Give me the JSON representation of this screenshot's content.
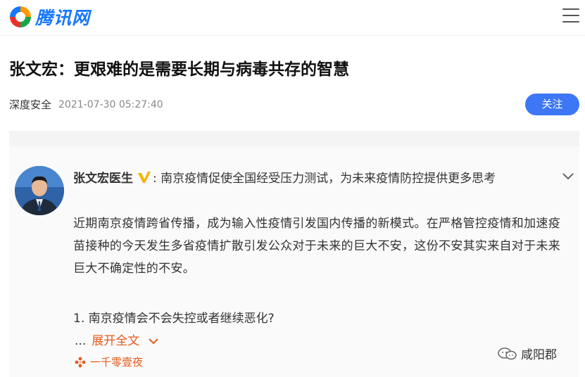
{
  "header": {
    "logo_text": "腾讯网",
    "logo_icon": "tencent-news-logo",
    "menu_icon": "hamburger-menu-icon"
  },
  "article": {
    "title": "张文宏：更艰难的是需要长期与病毒共存的智慧",
    "source": "深度安全",
    "time": "2021-07-30 05:27:40",
    "follow_label": "关注"
  },
  "post": {
    "author": "张文宏医生",
    "colon": ":",
    "summary": "南京疫情促使全国经受压力测试，为未来疫情防控提供更多思考",
    "paragraph": "近期南京疫情跨省传播，成为输入性疫情引发国内传播的新模式。在严格管控疫情和加速疫苗接种的今天发生多省疫情扩散引发公众对于未来的巨大不安，这份不安其实来自对于未来巨大不确定性的不安。",
    "item_1": "1. 南京疫情会不会失控或者继续恶化?",
    "expand_dots": "...",
    "expand_label": "展开全文",
    "tagline": "一千零壹夜"
  },
  "watermark": {
    "text": "咸阳郡"
  },
  "colors": {
    "brand_blue": "#1677ff",
    "follow_button": "#3d77f5",
    "accent_orange": "#e45a1c",
    "verified_gold": "#f5b400"
  }
}
